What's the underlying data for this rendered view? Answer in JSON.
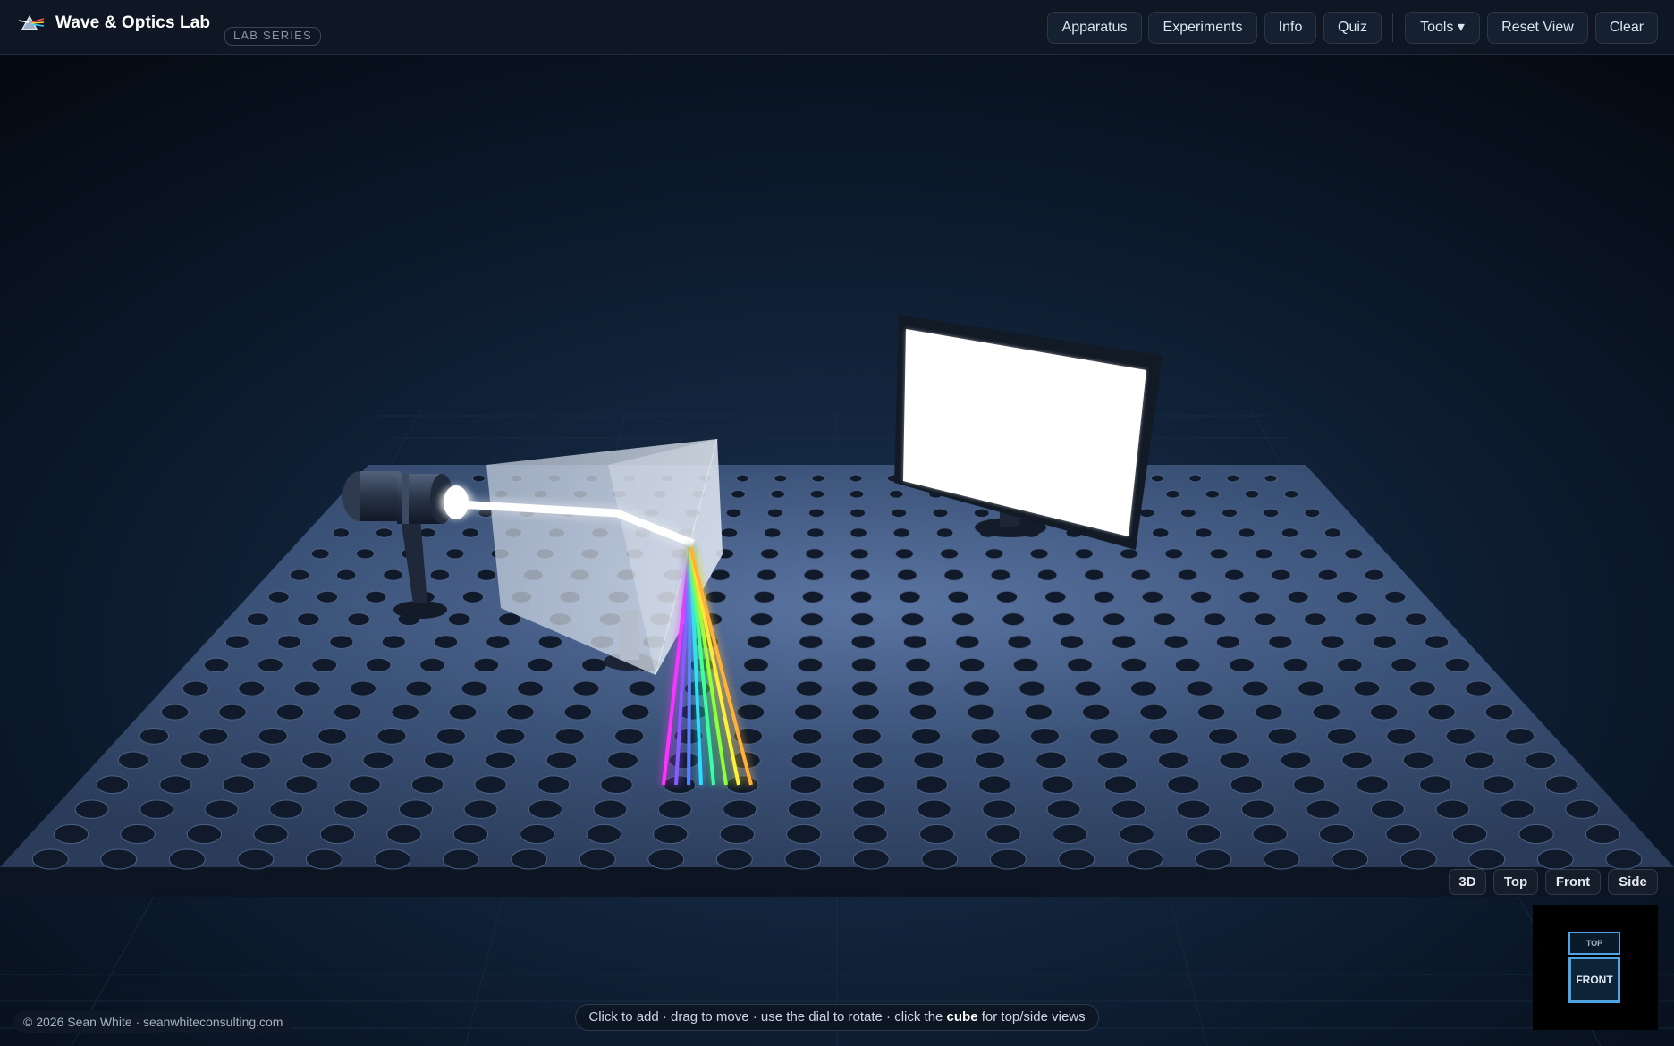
{
  "app": {
    "title": "Wave & Optics Lab",
    "badge": "LAB SERIES"
  },
  "nav": {
    "apparatus": "Apparatus",
    "experiments": "Experiments",
    "info": "Info",
    "quiz": "Quiz",
    "tools": "Tools ▾",
    "reset_view": "Reset View",
    "clear": "Clear"
  },
  "view_controls": {
    "v3d": "3D",
    "top": "Top",
    "front": "Front",
    "side": "Side"
  },
  "nav_cube": {
    "top_face": "TOP",
    "front_face": "FRONT"
  },
  "footer": {
    "copyright": "© 2026 Sean White · seanwhiteconsulting.com",
    "hint_before": "Click to add · drag to move · use the dial to rotate · click the ",
    "hint_bold": "cube",
    "hint_after": " for top/side views"
  },
  "scene": {
    "apparatus": [
      "light-source",
      "prism",
      "screen"
    ],
    "spectrum_colors": [
      "#ff33ff",
      "#8a5cff",
      "#5b7bff",
      "#33d9ff",
      "#39ffa0",
      "#8cff3c",
      "#fff23a",
      "#ffb13a"
    ]
  },
  "colors": {
    "background": "#0a1320",
    "topbar": "#0f1724",
    "accent": "#4fa3e0",
    "table": "#3a5075"
  }
}
